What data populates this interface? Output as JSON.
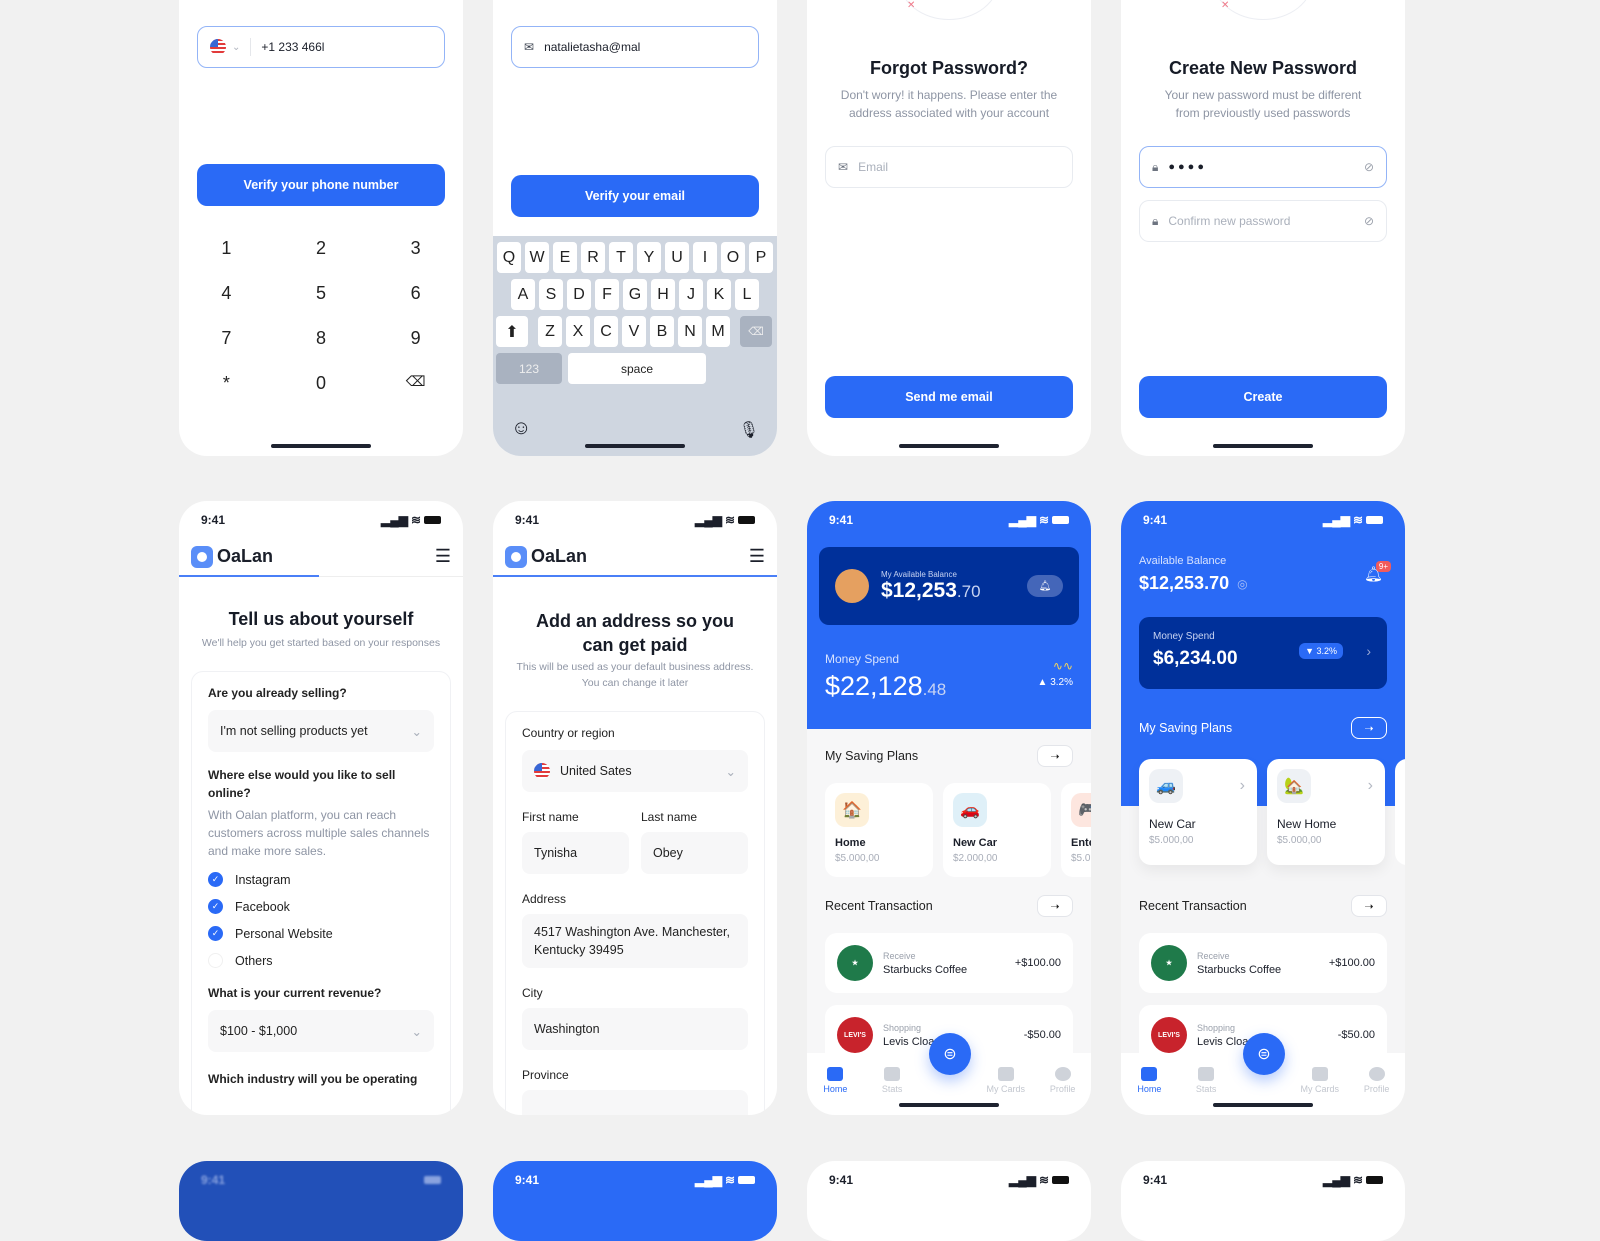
{
  "phone_verify": {
    "phone_value": "+1 233 466l",
    "verify_button": "Verify your phone number",
    "numpad": [
      "1",
      "2",
      "3",
      "4",
      "5",
      "6",
      "7",
      "8",
      "9",
      "*",
      "0",
      "⌫"
    ]
  },
  "email_verify": {
    "email_value": "natalietasha@mal",
    "verify_button": "Verify your email",
    "keyboard": {
      "row1": [
        "Q",
        "W",
        "E",
        "R",
        "T",
        "Y",
        "U",
        "I",
        "O",
        "P"
      ],
      "row2": [
        "A",
        "S",
        "D",
        "F",
        "G",
        "H",
        "J",
        "K",
        "L"
      ],
      "row3": [
        "Z",
        "X",
        "C",
        "V",
        "B",
        "N",
        "M"
      ],
      "num_key": "123",
      "space_key": "space"
    }
  },
  "forgot_password": {
    "title": "Forgot Password?",
    "subtitle": "Don't worry! it happens. Please enter the address associated with your account",
    "email_placeholder": "Email",
    "send_button": "Send me email"
  },
  "create_password": {
    "title": "Create New Password",
    "subtitle": "Your new password must be different from previoustly used passwords",
    "password_value": "●●●●",
    "confirm_placeholder": "Confirm new password",
    "create_button": "Create"
  },
  "status_time": "9:41",
  "brand": "OaLan",
  "about": {
    "title": "Tell us about yourself",
    "subtitle": "We'll help you get started based on your responses",
    "q1": "Are you already selling?",
    "q1_value": "I'm not selling products yet",
    "q2": "Where else would you like to sell online?",
    "q2_desc": "With Oalan platform, you can reach customers across multiple sales channels and make more sales.",
    "channels": [
      {
        "label": "Instagram",
        "checked": true
      },
      {
        "label": "Facebook",
        "checked": true
      },
      {
        "label": "Personal Website",
        "checked": true
      },
      {
        "label": "Others",
        "checked": false
      }
    ],
    "q3": "What is your current revenue?",
    "q3_value": "$100 - $1,000",
    "q4": "Which industry will you be operating"
  },
  "address": {
    "title": "Add an address so you can get paid",
    "subtitle": "This will be used as your default business address. You can change it later",
    "country_label": "Country or region",
    "country_value": "United Sates",
    "first_label": "First name",
    "first_value": "Tynisha",
    "last_label": "Last name",
    "last_value": "Obey",
    "address_label": "Address",
    "address_value": "4517 Washington Ave. Manchester, Kentucky 39495",
    "city_label": "City",
    "city_value": "Washington",
    "province_label": "Province"
  },
  "wallet1": {
    "balance_label": "My Available Balance",
    "balance_main": "$12,253",
    "balance_cents": ".70",
    "spend_label": "Money Spend",
    "spend_main": "$22,128",
    "spend_cents": ".48",
    "spend_change": "▲ 3.2%",
    "plans_title": "My Saving Plans",
    "plans": [
      {
        "name": "Home",
        "amount": "$5.000,00",
        "icon": "🏠"
      },
      {
        "name": "New Car",
        "amount": "$2.000,00",
        "icon": "🚗"
      },
      {
        "name": "Ente",
        "amount": "$5.0",
        "icon": "🎮"
      }
    ],
    "tx_title": "Recent Transaction",
    "transactions": [
      {
        "category": "Receive",
        "name": "Starbucks Coffee",
        "amount": "+$100.00"
      },
      {
        "category": "Shopping",
        "name": "Levis Cloa",
        "amount": "-$50.00"
      }
    ]
  },
  "wallet2": {
    "balance_label": "Available Balance",
    "balance": "$12,253.70",
    "notif_badge": "9+",
    "spend_label": "Money Spend",
    "spend": "$6,234.00",
    "spend_change": "▼ 3.2%",
    "plans_title": "My Saving Plans",
    "plans": [
      {
        "name": "New Car",
        "amount": "$5.000,00",
        "icon": "🚙"
      },
      {
        "name": "New Home",
        "amount": "$5.000,00",
        "icon": "🏡"
      }
    ],
    "tx_title": "Recent Transaction",
    "transactions": [
      {
        "category": "Receive",
        "name": "Starbucks Coffee",
        "amount": "+$100.00"
      },
      {
        "category": "Shopping",
        "name": "Levis Cloa",
        "amount": "-$50.00"
      }
    ]
  },
  "tabs": [
    "Home",
    "Stats",
    "My Cards",
    "Profile"
  ],
  "colors": {
    "primary": "#2a6af6",
    "dark_card": "#00309a",
    "background": "#f1f1f1"
  }
}
